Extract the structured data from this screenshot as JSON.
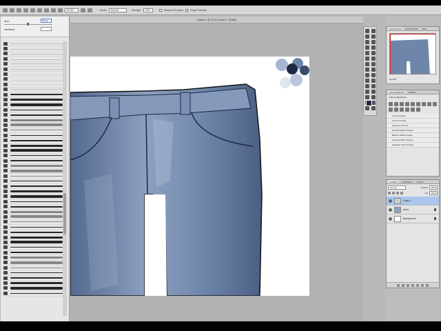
{
  "window": {
    "document_title": "Untitled-1 @ 33.3% (Layer 1, RGB/8)"
  },
  "options_bar": {
    "zoom": "33.3%",
    "mode_label": "Mode:",
    "mode_value": "Normal",
    "strength_label": "Strength:",
    "strength_value": "50%",
    "sample_all_layers": "Sample All Layers",
    "finger_painting": "Finger Painting"
  },
  "brush_panel": {
    "size_label": "Size:",
    "size_value": "98 px",
    "hardness_label": "Hardness:",
    "brush_count": 50
  },
  "navigator": {
    "tabs": [
      "NAVIGATOR",
      "HISTOGRAM",
      "INFO"
    ],
    "zoom": "33.33%"
  },
  "adjustments": {
    "tabs": [
      "ADJUSTMENTS",
      "MASKS"
    ],
    "heading": "Add an adjustment",
    "presets": [
      "Levels Presets",
      "Curves Presets",
      "Exposure Presets",
      "Hue/Saturation Presets",
      "Black & White Presets",
      "Channel Mixer Presets",
      "Selective Color Presets"
    ]
  },
  "layers": {
    "tabs": [
      "LAYERS",
      "CHANNELS",
      "PATHS"
    ],
    "blend_mode": "Normal",
    "opacity_label": "Opacity:",
    "opacity_value": "100%",
    "fill_label": "Fill:",
    "fill_value": "100%",
    "items": [
      {
        "name": "Layer 1",
        "selected": true
      },
      {
        "name": "jeans",
        "selected": false
      },
      {
        "name": "Background",
        "selected": false
      }
    ]
  },
  "colors": {
    "denim": "#6f86ab",
    "denim_dark": "#3b4c6e",
    "denim_light": "#a9b8d2",
    "foreground": "#1f2a46",
    "selection": "#aac6ee"
  }
}
